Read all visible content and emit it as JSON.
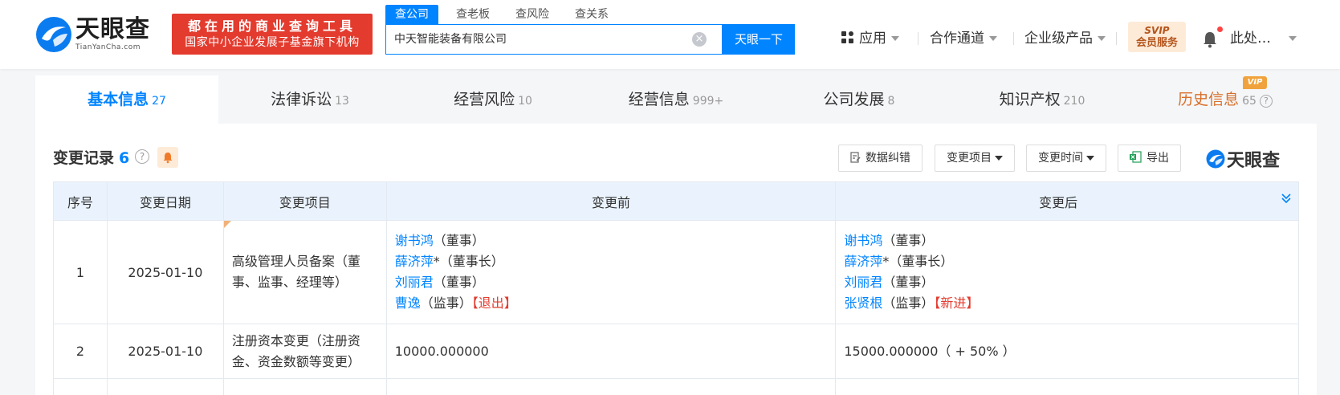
{
  "brand": {
    "name_cn": "天眼查",
    "name_en": "TianYanCha.com",
    "slogan_line1": "都在用的商业查询工具",
    "slogan_line2": "国家中小企业发展子基金旗下机构"
  },
  "search": {
    "tabs": [
      "查公司",
      "查老板",
      "查风险",
      "查关系"
    ],
    "value": "中天智能装备有限公司",
    "button": "天眼一下"
  },
  "nav": {
    "apps": "应用",
    "channel": "合作通道",
    "enterprise": "企业级产品",
    "svip_top": "SVIP",
    "svip_bottom": "会员服务",
    "user": "此处…"
  },
  "tabs": [
    {
      "label": "基本信息",
      "count": "27"
    },
    {
      "label": "法律诉讼",
      "count": "13"
    },
    {
      "label": "经营风险",
      "count": "10"
    },
    {
      "label": "经营信息",
      "count": "999+"
    },
    {
      "label": "公司发展",
      "count": "8"
    },
    {
      "label": "知识产权",
      "count": "210"
    },
    {
      "label": "历史信息",
      "count": "65",
      "badge": "VIP"
    }
  ],
  "section": {
    "title": "变更记录",
    "count": "6",
    "buttons": {
      "correction": "数据纠错",
      "item_filter": "变更项目",
      "time_filter": "变更时间",
      "export": "导出"
    },
    "mini_logo": "天眼查"
  },
  "table": {
    "headers": [
      "序号",
      "变更日期",
      "变更项目",
      "变更前",
      "变更后"
    ],
    "rows": [
      {
        "index": "1",
        "date": "2025-01-10",
        "item": "高级管理人员备案（董事、监事、经理等）",
        "before": [
          {
            "name": "谢书鸿",
            "role": "（董事）",
            "tag": ""
          },
          {
            "name": "薛济萍",
            "role": "*（董事长）",
            "tag": ""
          },
          {
            "name": "刘丽君",
            "role": "（董事）",
            "tag": ""
          },
          {
            "name": "曹逸",
            "role": "（监事）",
            "tag": "【退出】"
          }
        ],
        "after": [
          {
            "name": "谢书鸿",
            "role": "（董事）",
            "tag": ""
          },
          {
            "name": "薛济萍",
            "role": "*（董事长）",
            "tag": ""
          },
          {
            "name": "刘丽君",
            "role": "（董事）",
            "tag": ""
          },
          {
            "name": "张贤根",
            "role": "（监事）",
            "tag": "【新进】"
          }
        ]
      },
      {
        "index": "2",
        "date": "2025-01-10",
        "item": "注册资本变更（注册资金、资金数额等变更）",
        "before_text": "10000.000000",
        "after_text": "15000.000000（ + 50% ）"
      }
    ]
  },
  "colors": {
    "primary": "#0084ff",
    "brand_red": "#e33b2e",
    "history_orange": "#d8702a",
    "header_bg": "#eaf3fd"
  }
}
